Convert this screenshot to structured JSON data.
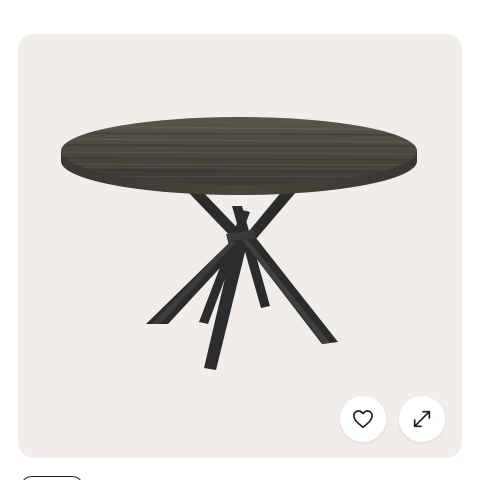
{
  "screen": {
    "background": "#ffffff",
    "card_background": "#f1ede8"
  },
  "product": {
    "image_subject": "round-dining-table",
    "top_color": "#4d4842",
    "leg_color": "#2b2b2b"
  },
  "actions": {
    "favorite": {
      "icon": "heart-icon"
    },
    "expand": {
      "icon": "expand-arrows-icon"
    }
  }
}
